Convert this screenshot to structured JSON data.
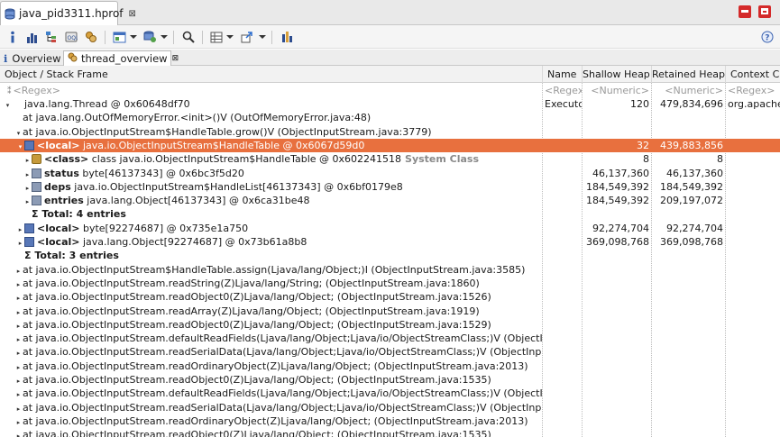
{
  "editor": {
    "tab_title": "java_pid3311.hprof",
    "tab_close": "⊠",
    "minimize_icon": "minimize-icon",
    "maximize_icon": "maximize-icon"
  },
  "toolbar": {
    "buttons": [
      "info-icon",
      "histogram-icon",
      "dominator-tree-icon",
      "oql-icon",
      "thread-overview-icon",
      "query-browser-icon",
      "heap-dump-overview-icon",
      "search-icon",
      "group-by-icon",
      "export-icon",
      "calculate-retained-icon",
      "help-icon"
    ]
  },
  "view_tabs": {
    "overview_label": "Overview",
    "thread_overview_label": "thread_overview",
    "close_glyph": "⊠"
  },
  "columns": {
    "object": "Object / Stack Frame",
    "name": "Name",
    "shallow": "Shallow Heap",
    "retained": "Retained Heap",
    "context": "Context Cl"
  },
  "filter_row": {
    "object": "<Regex>",
    "name": "<Regex>",
    "shallow": "<Numeric>",
    "retained": "<Numeric>",
    "context": "<Regex>"
  },
  "rows": [
    {
      "indent": 0,
      "twisty": "▾",
      "icon": "thread",
      "bold_prefix": "",
      "text": "java.lang.Thread @ 0x60648df70",
      "suffix": "",
      "name": "Executo",
      "shallow": "120",
      "retained": "479,834,696",
      "context": "org.apache",
      "selected": false
    },
    {
      "indent": 1,
      "twisty": "",
      "icon": "",
      "bold_prefix": "",
      "text": "at java.lang.OutOfMemoryError.<init>()V (OutOfMemoryError.java:48)",
      "suffix": "",
      "name": "",
      "shallow": "",
      "retained": "",
      "context": "",
      "selected": false
    },
    {
      "indent": 1,
      "twisty": "▾",
      "icon": "",
      "bold_prefix": "",
      "text": "at java.io.ObjectInputStream$HandleTable.grow()V (ObjectInputStream.java:3779)",
      "suffix": "",
      "name": "",
      "shallow": "",
      "retained": "",
      "context": "",
      "selected": false
    },
    {
      "indent": 2,
      "twisty": "▾",
      "icon": "local",
      "bold_prefix": "<local>",
      "text": " java.io.ObjectInputStream$HandleTable @ 0x6067d59d0",
      "suffix": "",
      "name": "",
      "shallow": "32",
      "retained": "439,883,856",
      "context": "",
      "selected": true
    },
    {
      "indent": 3,
      "twisty": "▸",
      "icon": "cls",
      "bold_prefix": "<class>",
      "text": " class java.io.ObjectInputStream$HandleTable @ 0x602241518",
      "suffix": "System Class",
      "name": "",
      "shallow": "8",
      "retained": "8",
      "context": "",
      "selected": false
    },
    {
      "indent": 3,
      "twisty": "▸",
      "icon": "fld",
      "bold_prefix": "status",
      "text": " byte[46137343] @ 0x6bc3f5d20",
      "suffix": "",
      "name": "",
      "shallow": "46,137,360",
      "retained": "46,137,360",
      "context": "",
      "selected": false
    },
    {
      "indent": 3,
      "twisty": "▸",
      "icon": "fld",
      "bold_prefix": "deps",
      "text": " java.io.ObjectInputStream$HandleList[46137343] @ 0x6bf0179e8",
      "suffix": "",
      "name": "",
      "shallow": "184,549,392",
      "retained": "184,549,392",
      "context": "",
      "selected": false
    },
    {
      "indent": 3,
      "twisty": "▸",
      "icon": "fld",
      "bold_prefix": "entries",
      "text": " java.lang.Object[46137343] @ 0x6ca31be48",
      "suffix": "",
      "name": "",
      "shallow": "184,549,392",
      "retained": "209,197,072",
      "context": "",
      "selected": false
    },
    {
      "indent": 3,
      "twisty": "",
      "icon": "",
      "bold_prefix": "Σ Total: 4 entries",
      "text": "",
      "suffix": "",
      "name": "",
      "shallow": "",
      "retained": "",
      "context": "",
      "selected": false
    },
    {
      "indent": 2,
      "twisty": "▸",
      "icon": "local",
      "bold_prefix": "<local>",
      "text": " byte[92274687] @ 0x735e1a750",
      "suffix": "",
      "name": "",
      "shallow": "92,274,704",
      "retained": "92,274,704",
      "context": "",
      "selected": false
    },
    {
      "indent": 2,
      "twisty": "▸",
      "icon": "local",
      "bold_prefix": "<local>",
      "text": " java.lang.Object[92274687] @ 0x73b61a8b8",
      "suffix": "",
      "name": "",
      "shallow": "369,098,768",
      "retained": "369,098,768",
      "context": "",
      "selected": false
    },
    {
      "indent": 2,
      "twisty": "",
      "icon": "",
      "bold_prefix": "Σ Total: 3 entries",
      "text": "",
      "suffix": "",
      "name": "",
      "shallow": "",
      "retained": "",
      "context": "",
      "selected": false
    },
    {
      "indent": 1,
      "twisty": "▸",
      "icon": "",
      "bold_prefix": "",
      "text": "at java.io.ObjectInputStream$HandleTable.assign(Ljava/lang/Object;)I (ObjectInputStream.java:3585)",
      "suffix": "",
      "name": "",
      "shallow": "",
      "retained": "",
      "context": "",
      "selected": false
    },
    {
      "indent": 1,
      "twisty": "▸",
      "icon": "",
      "bold_prefix": "",
      "text": "at java.io.ObjectInputStream.readString(Z)Ljava/lang/String; (ObjectInputStream.java:1860)",
      "suffix": "",
      "name": "",
      "shallow": "",
      "retained": "",
      "context": "",
      "selected": false
    },
    {
      "indent": 1,
      "twisty": "▸",
      "icon": "",
      "bold_prefix": "",
      "text": "at java.io.ObjectInputStream.readObject0(Z)Ljava/lang/Object; (ObjectInputStream.java:1526)",
      "suffix": "",
      "name": "",
      "shallow": "",
      "retained": "",
      "context": "",
      "selected": false
    },
    {
      "indent": 1,
      "twisty": "▸",
      "icon": "",
      "bold_prefix": "",
      "text": "at java.io.ObjectInputStream.readArray(Z)Ljava/lang/Object; (ObjectInputStream.java:1919)",
      "suffix": "",
      "name": "",
      "shallow": "",
      "retained": "",
      "context": "",
      "selected": false
    },
    {
      "indent": 1,
      "twisty": "▸",
      "icon": "",
      "bold_prefix": "",
      "text": "at java.io.ObjectInputStream.readObject0(Z)Ljava/lang/Object; (ObjectInputStream.java:1529)",
      "suffix": "",
      "name": "",
      "shallow": "",
      "retained": "",
      "context": "",
      "selected": false
    },
    {
      "indent": 1,
      "twisty": "▸",
      "icon": "",
      "bold_prefix": "",
      "text": "at java.io.ObjectInputStream.defaultReadFields(Ljava/lang/Object;Ljava/io/ObjectStreamClass;)V (ObjectInputStre",
      "suffix": "",
      "name": "",
      "shallow": "",
      "retained": "",
      "context": "",
      "selected": false
    },
    {
      "indent": 1,
      "twisty": "▸",
      "icon": "",
      "bold_prefix": "",
      "text": "at java.io.ObjectInputStream.readSerialData(Ljava/lang/Object;Ljava/io/ObjectStreamClass;)V (ObjectInputStre",
      "suffix": "",
      "name": "",
      "shallow": "",
      "retained": "",
      "context": "",
      "selected": false
    },
    {
      "indent": 1,
      "twisty": "▸",
      "icon": "",
      "bold_prefix": "",
      "text": "at java.io.ObjectInputStream.readOrdinaryObject(Z)Ljava/lang/Object; (ObjectInputStream.java:2013)",
      "suffix": "",
      "name": "",
      "shallow": "",
      "retained": "",
      "context": "",
      "selected": false
    },
    {
      "indent": 1,
      "twisty": "▸",
      "icon": "",
      "bold_prefix": "",
      "text": "at java.io.ObjectInputStream.readObject0(Z)Ljava/lang/Object; (ObjectInputStream.java:1535)",
      "suffix": "",
      "name": "",
      "shallow": "",
      "retained": "",
      "context": "",
      "selected": false
    },
    {
      "indent": 1,
      "twisty": "▸",
      "icon": "",
      "bold_prefix": "",
      "text": "at java.io.ObjectInputStream.defaultReadFields(Ljava/lang/Object;Ljava/io/ObjectStreamClass;)V (ObjectInputStre",
      "suffix": "",
      "name": "",
      "shallow": "",
      "retained": "",
      "context": "",
      "selected": false
    },
    {
      "indent": 1,
      "twisty": "▸",
      "icon": "",
      "bold_prefix": "",
      "text": "at java.io.ObjectInputStream.readSerialData(Ljava/lang/Object;Ljava/io/ObjectStreamClass;)V (ObjectInputStre",
      "suffix": "",
      "name": "",
      "shallow": "",
      "retained": "",
      "context": "",
      "selected": false
    },
    {
      "indent": 1,
      "twisty": "▸",
      "icon": "",
      "bold_prefix": "",
      "text": "at java.io.ObjectInputStream.readOrdinaryObject(Z)Ljava/lang/Object; (ObjectInputStream.java:2013)",
      "suffix": "",
      "name": "",
      "shallow": "",
      "retained": "",
      "context": "",
      "selected": false
    },
    {
      "indent": 1,
      "twisty": "▸",
      "icon": "",
      "bold_prefix": "",
      "text": "at java.io.ObjectInputStream.readObject0(Z)Ljava/lang/Object; (ObjectInputStream.java:1535)",
      "suffix": "",
      "name": "",
      "shallow": "",
      "retained": "",
      "context": "",
      "selected": false
    }
  ],
  "colors": {
    "selection": "#e8703e",
    "close_buttons": "#d42a2a"
  }
}
